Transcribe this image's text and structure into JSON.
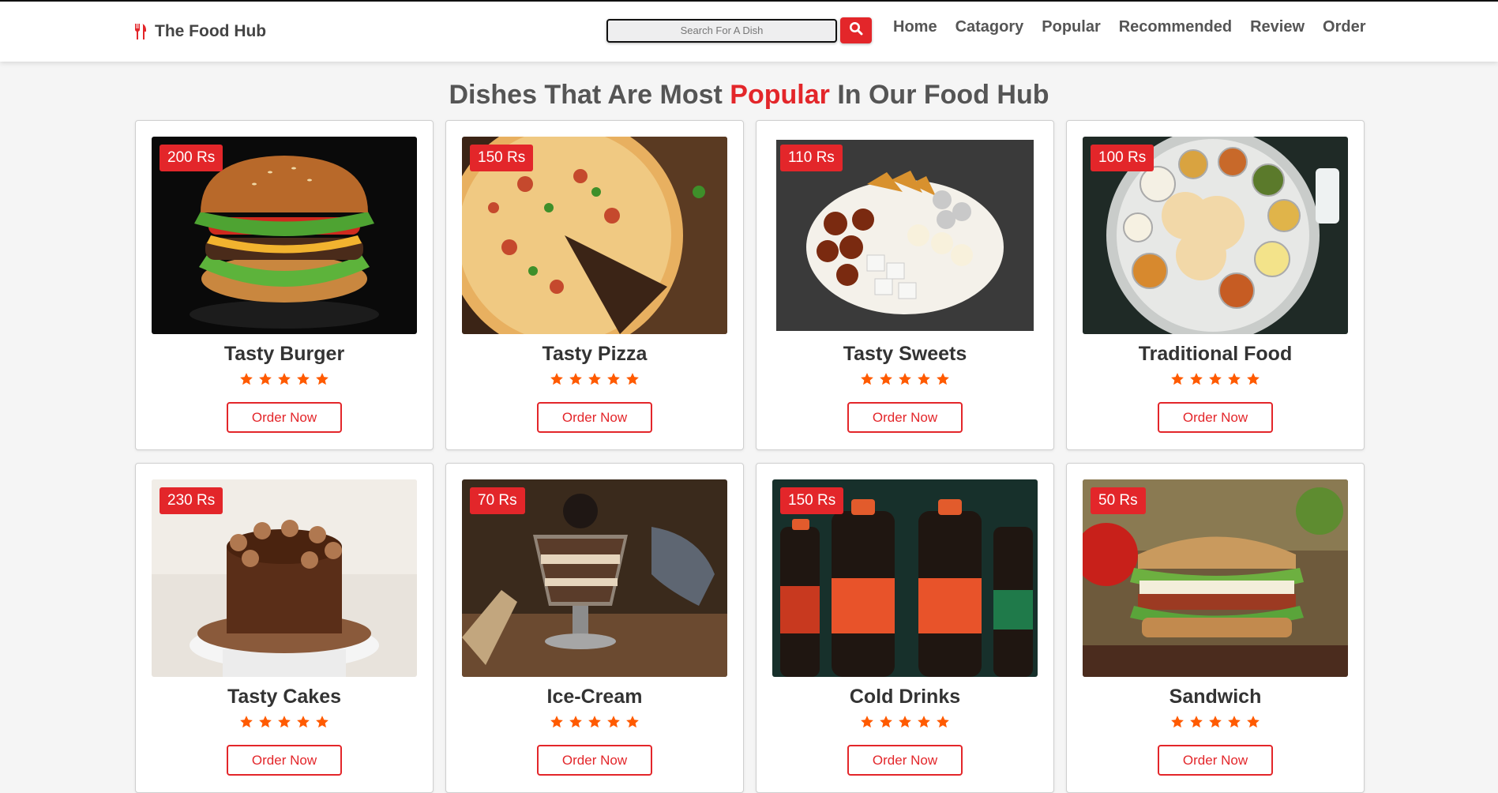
{
  "header": {
    "brand": "The Food Hub",
    "search_placeholder": "Search For A Dish",
    "nav": [
      "Home",
      "Catagory",
      "Popular",
      "Recommended",
      "Review",
      "Order"
    ]
  },
  "section": {
    "title_before": "Dishes That Are Most",
    "title_highlight": "Popular",
    "title_after": "In Our Food Hub"
  },
  "colors": {
    "accent": "#e3262a",
    "star": "#ff5a00",
    "text": "#555555"
  },
  "dishes": [
    {
      "name": "Tasty Burger",
      "price": "200 Rs",
      "rating": 5,
      "order_label": "Order Now",
      "image": "burger-photo"
    },
    {
      "name": "Tasty Pizza",
      "price": "150 Rs",
      "rating": 5,
      "order_label": "Order Now",
      "image": "pizza-photo"
    },
    {
      "name": "Tasty Sweets",
      "price": "110 Rs",
      "rating": 5,
      "order_label": "Order Now",
      "image": "sweets-photo"
    },
    {
      "name": "Traditional Food",
      "price": "100 Rs",
      "rating": 5,
      "order_label": "Order Now",
      "image": "thali-photo"
    },
    {
      "name": "Tasty Cakes",
      "price": "230 Rs",
      "rating": 5,
      "order_label": "Order Now",
      "image": "cake-photo"
    },
    {
      "name": "Ice-Cream",
      "price": "70 Rs",
      "rating": 5,
      "order_label": "Order Now",
      "image": "icecream-photo"
    },
    {
      "name": "Cold Drinks",
      "price": "150 Rs",
      "rating": 5,
      "order_label": "Order Now",
      "image": "colddrinks-photo"
    },
    {
      "name": "Sandwich",
      "price": "50 Rs",
      "rating": 5,
      "order_label": "Order Now",
      "image": "sandwich-photo"
    }
  ]
}
